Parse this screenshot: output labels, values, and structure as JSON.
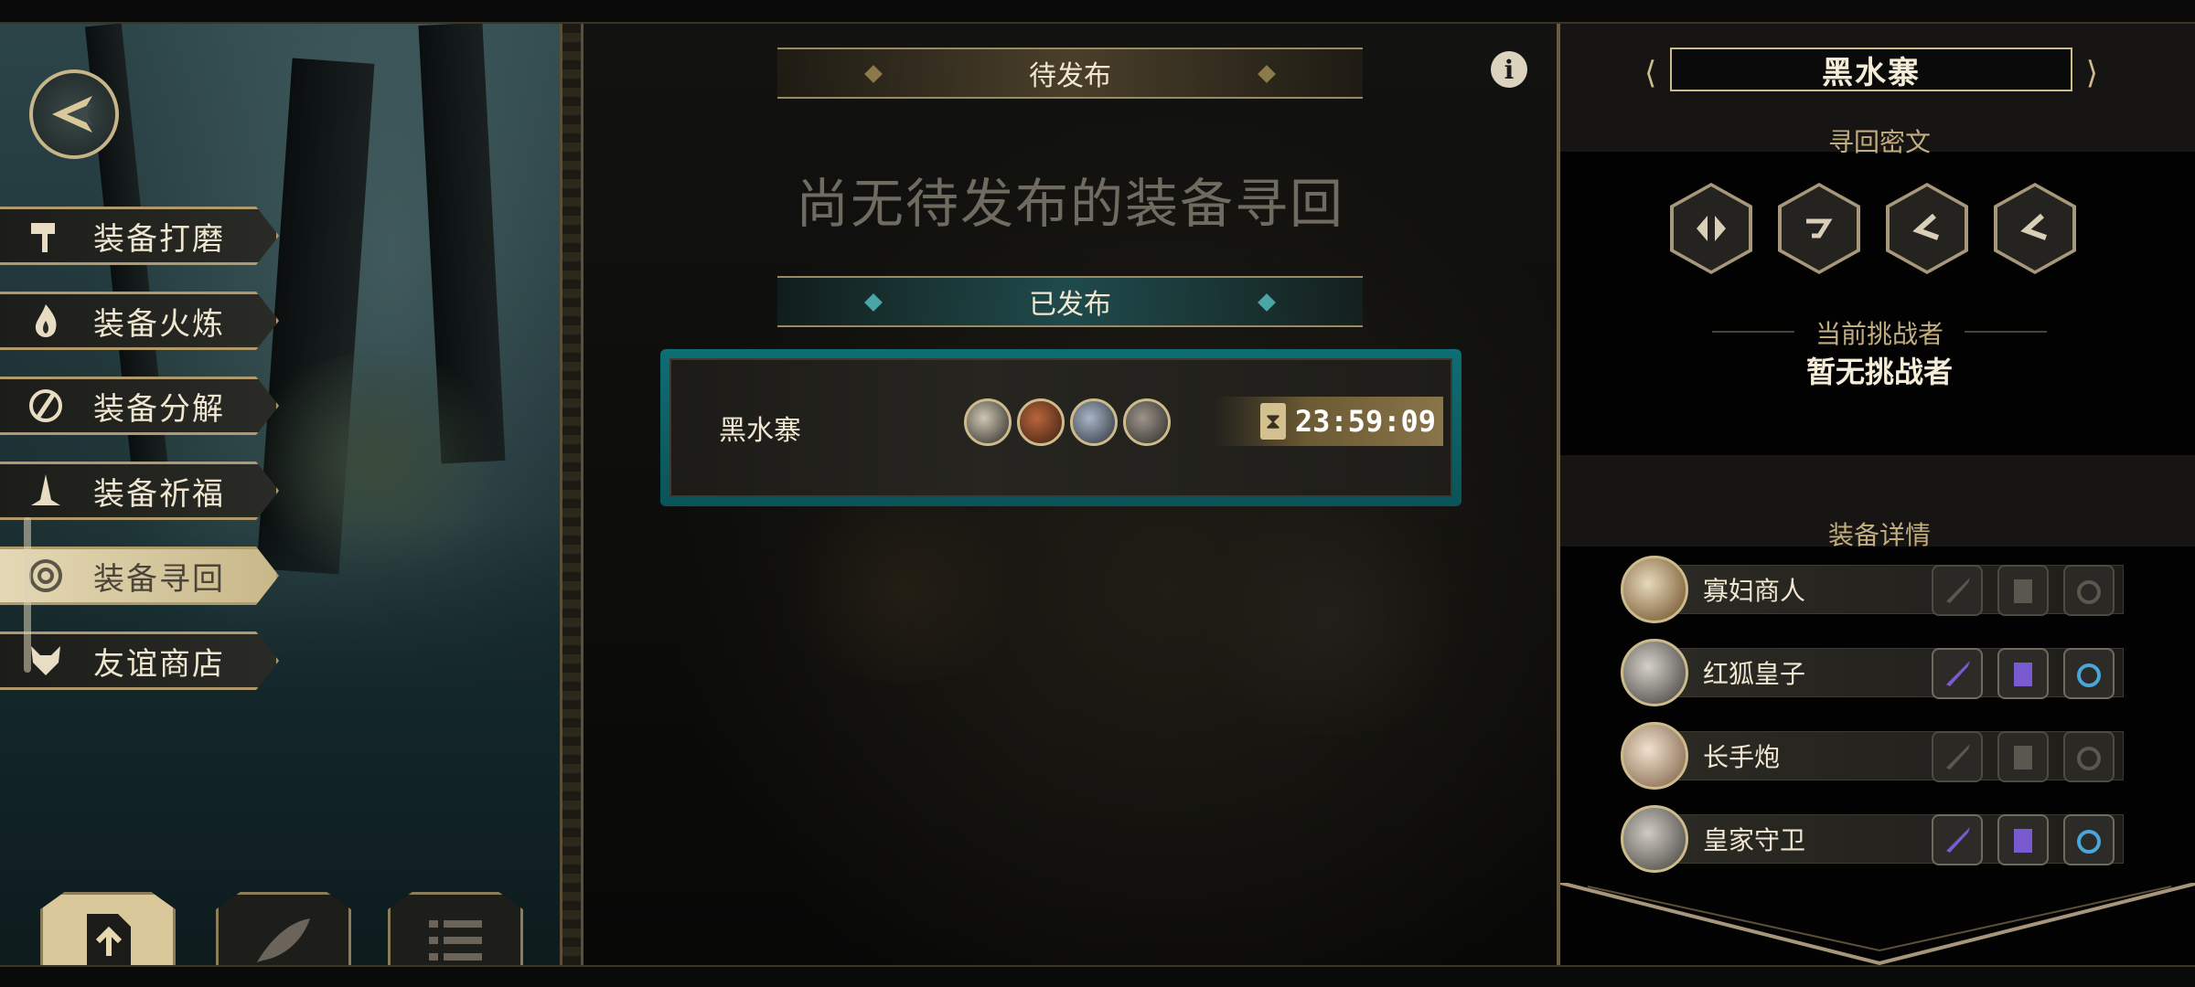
{
  "left_menu": {
    "items": [
      {
        "label": "装备打磨",
        "icon": "hammer-icon",
        "active": false
      },
      {
        "label": "装备火炼",
        "icon": "flame-icon",
        "active": false
      },
      {
        "label": "装备分解",
        "icon": "disassemble-icon",
        "active": false
      },
      {
        "label": "装备祈福",
        "icon": "pray-icon",
        "active": false
      },
      {
        "label": "装备寻回",
        "icon": "target-icon",
        "active": true
      },
      {
        "label": "友谊商店",
        "icon": "fox-icon",
        "active": false
      }
    ],
    "bottom_tabs": [
      {
        "icon": "upload-file-icon",
        "active": true
      },
      {
        "icon": "feather-icon",
        "active": false
      },
      {
        "icon": "list-icon",
        "active": false
      }
    ]
  },
  "center": {
    "pending_header": "待发布",
    "empty_text": "尚无待发布的装备寻回",
    "published_header": "已发布",
    "published": [
      {
        "name": "黑水寨",
        "timer": "23:59:09",
        "avatar_colors": [
          "#cfc7b3",
          "#b9663b",
          "#a9b6c7",
          "#9c958b"
        ]
      }
    ]
  },
  "right_panel": {
    "title": "黑水寨",
    "secret_label": "寻回密文",
    "runes": [
      "rune-1-icon",
      "rune-2-icon",
      "rune-3-icon",
      "rune-4-icon"
    ],
    "challenger_label": "当前挑战者",
    "challenger_value": "暂无挑战者",
    "equip_label": "装备详情",
    "equipment": [
      {
        "name": "寡妇商人",
        "avatar_color": "#c8a36b",
        "slots": [
          false,
          false,
          false
        ]
      },
      {
        "name": "红狐皇子",
        "avatar_color": "#8d8a85",
        "slots": [
          true,
          true,
          true
        ]
      },
      {
        "name": "长手炮",
        "avatar_color": "#b8957b",
        "slots": [
          false,
          false,
          false
        ]
      },
      {
        "name": "皇家守卫",
        "avatar_color": "#9a9690",
        "slots": [
          true,
          true,
          true
        ]
      }
    ]
  },
  "colors": {
    "gold": "#cdbb8c",
    "teal": "#0e6e73",
    "purple_item": "#7a5ad0",
    "blue_item": "#4aa6d8"
  }
}
